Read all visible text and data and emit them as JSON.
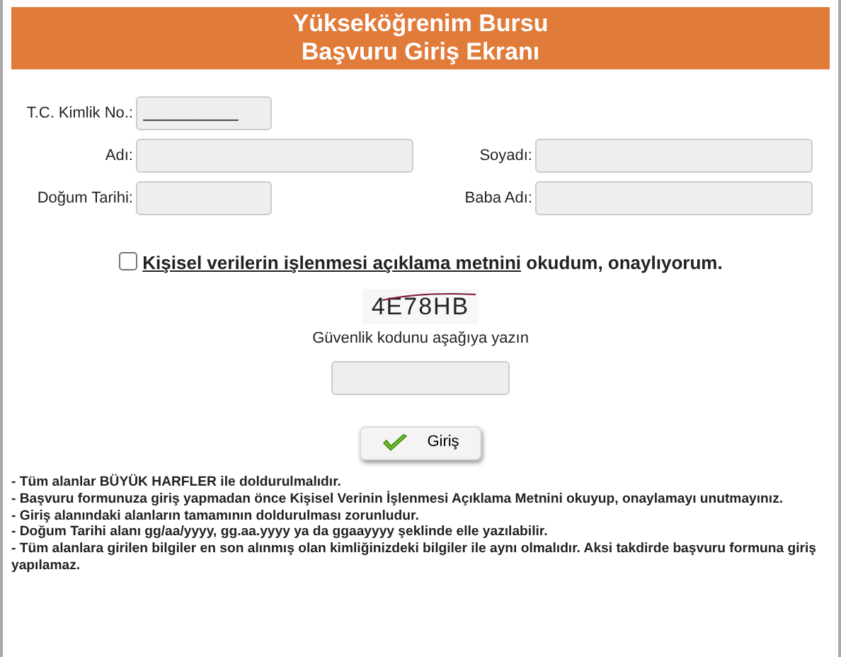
{
  "header": {
    "title_lines": [
      "Yükseköğrenim Bursu",
      "Başvuru Giriş Ekranı"
    ]
  },
  "fields": [
    {
      "label": "T.C. Kimlik No.:",
      "value": "___________",
      "kind": "short"
    },
    {
      "label": "Adı:",
      "kind": "long"
    },
    {
      "label": "Soyadı:",
      "kind": "long"
    },
    {
      "label": "Doğum Tarihi:",
      "kind": "short"
    },
    {
      "label": "Baba Adı:",
      "kind": "long"
    }
  ],
  "consent": {
    "checked": false,
    "link": "Kişisel verilerin işlenmesi açıklama metnini",
    "text": "okudum, onaylıyorum."
  },
  "captcha": {
    "code": "4E78HB",
    "instruction": "Güvenlik kodunu aşağıya yazın"
  },
  "submit_button": {
    "label": "Giriş"
  },
  "notes": [
    "- Tüm alanlar BÜYÜK HARFLER ile doldurulmalıdır.",
    "- Başvuru formunuza giriş yapmadan önce Kişisel Verinin İşlenmesi Açıklama Metnini okuyup, onaylamayı unutmayınız.",
    "- Giriş alanındaki alanların tamamının doldurulması zorunludur.",
    "- Doğum Tarihi alanı gg/aa/yyyy, gg.aa.yyyy ya da ggaayyyy şeklinde elle yazılabilir.",
    "- Tüm alanlara girilen bilgiler en son alınmış olan kimliğinizdeki bilgiler ile aynı olmalıdır. Aksi takdirde başvuru formuna giriş yapılamaz."
  ]
}
